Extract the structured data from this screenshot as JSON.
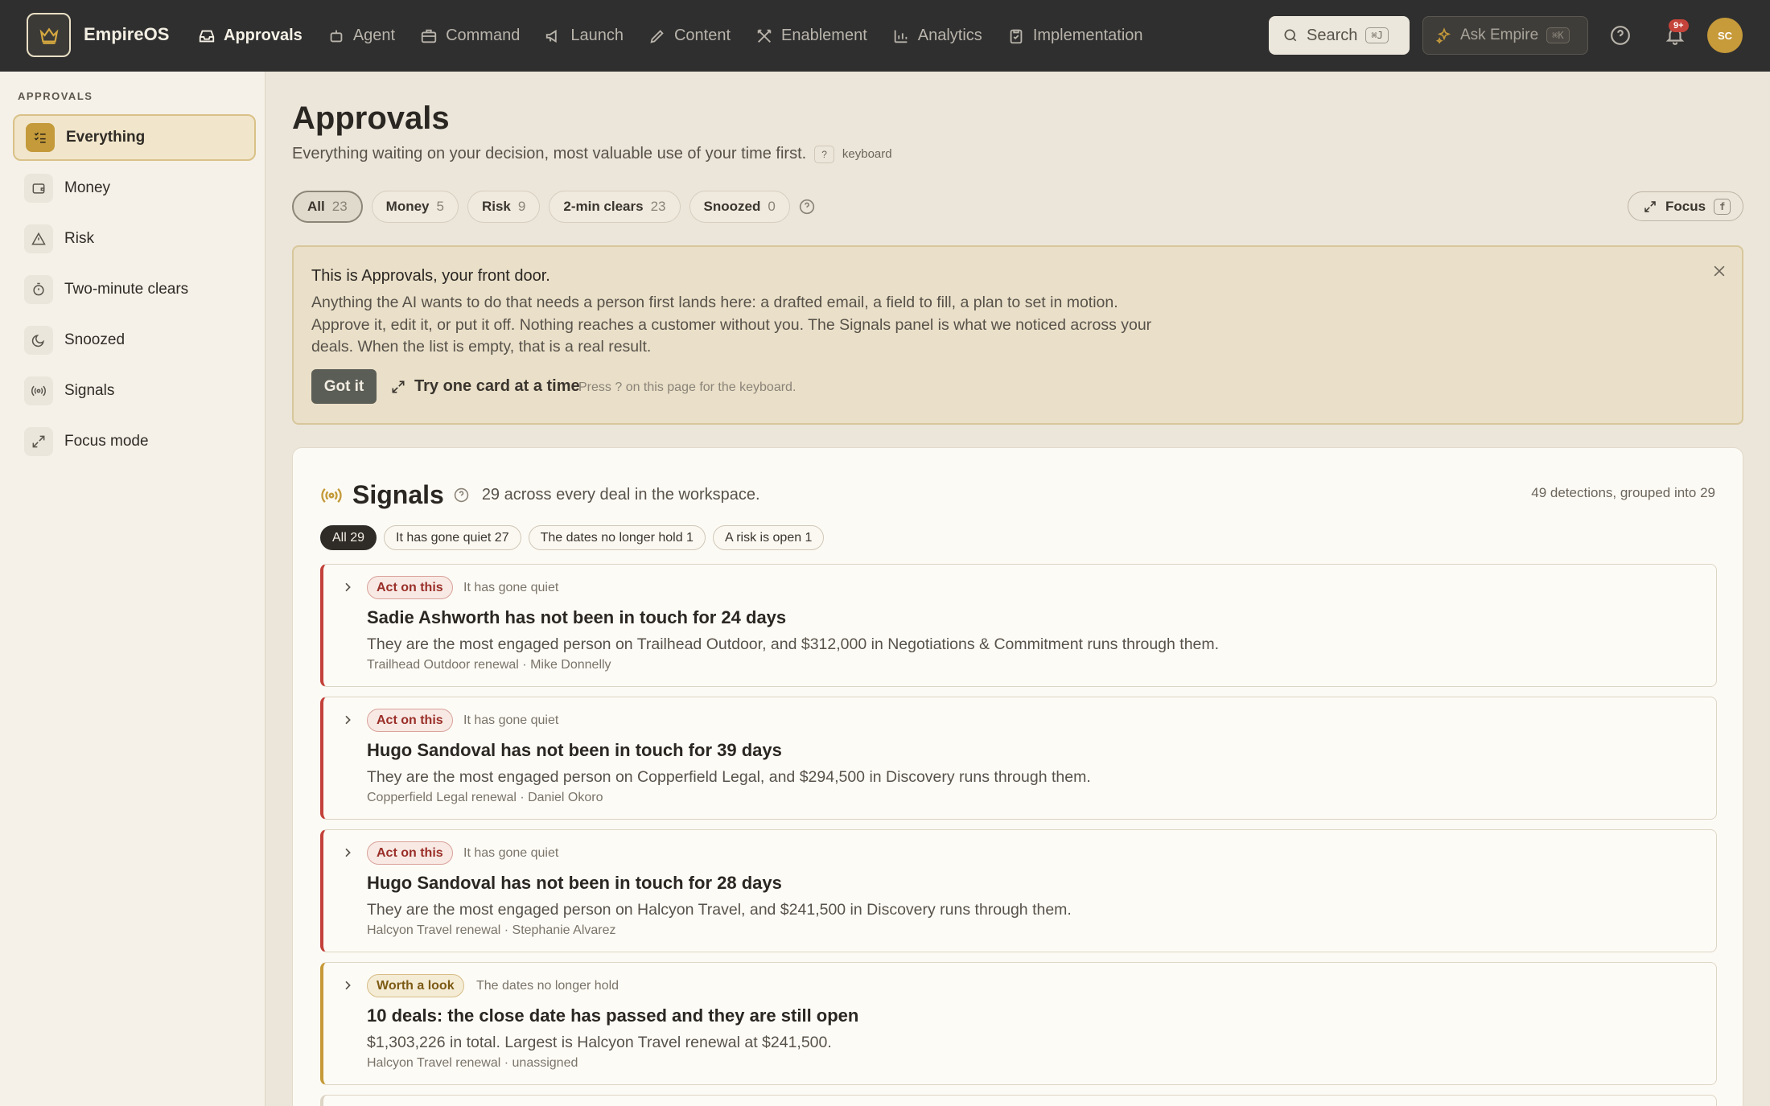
{
  "topbar": {
    "brand": "EmpireOS",
    "nav": [
      {
        "label": "Approvals",
        "icon": "inbox-icon",
        "active": true
      },
      {
        "label": "Agent",
        "icon": "bot-icon"
      },
      {
        "label": "Command",
        "icon": "briefcase-icon"
      },
      {
        "label": "Launch",
        "icon": "megaphone-icon"
      },
      {
        "label": "Content",
        "icon": "pen-icon"
      },
      {
        "label": "Enablement",
        "icon": "crossed-swords-icon"
      },
      {
        "label": "Analytics",
        "icon": "bar-chart-icon"
      },
      {
        "label": "Implementation",
        "icon": "clipboard-check-icon"
      }
    ],
    "search": {
      "label": "Search",
      "shortcut": "⌘J"
    },
    "ask": {
      "label": "Ask Empire",
      "shortcut": "⌘K"
    },
    "notifications_badge": "9+",
    "avatar_initials": "SC"
  },
  "sidebar": {
    "heading": "APPROVALS",
    "items": [
      {
        "label": "Everything",
        "icon": "checklist-icon",
        "active": true
      },
      {
        "label": "Money",
        "icon": "wallet-icon"
      },
      {
        "label": "Risk",
        "icon": "warning-icon"
      },
      {
        "label": "Two-minute clears",
        "icon": "timer-icon"
      },
      {
        "label": "Snoozed",
        "icon": "moon-icon"
      },
      {
        "label": "Signals",
        "icon": "broadcast-icon"
      },
      {
        "label": "Focus mode",
        "icon": "expand-icon"
      }
    ]
  },
  "main": {
    "title": "Approvals",
    "subtitle": "Everything waiting on your decision, most valuable use of your time first.",
    "kbd_hint": "?",
    "kbd_label": "keyboard",
    "filters": [
      {
        "label": "All",
        "count": "23",
        "active": true
      },
      {
        "label": "Money",
        "count": "5"
      },
      {
        "label": "Risk",
        "count": "9"
      },
      {
        "label": "2-min clears",
        "count": "23"
      },
      {
        "label": "Snoozed",
        "count": "0"
      }
    ],
    "focus": {
      "label": "Focus",
      "shortcut": "f"
    }
  },
  "intro": {
    "title": "This is Approvals, your front door.",
    "text": "Anything the AI wants to do that needs a person first lands here: a drafted email, a field to fill, a plan to set in motion. Approve it, edit it, or put it off. Nothing reaches a customer without you. The Signals panel is what we noticed across your deals. When the list is empty, that is a real result.",
    "got_it": "Got it",
    "try_one": "Try one card at a time",
    "press_hint": "Press ? on this page for the keyboard."
  },
  "signals": {
    "title": "Signals",
    "count_text": "29 across every deal in the workspace.",
    "detections": "49 detections, grouped into 29",
    "chips": [
      {
        "label": "All 29",
        "active": true
      },
      {
        "label": "It has gone quiet 27"
      },
      {
        "label": "The dates no longer hold 1"
      },
      {
        "label": "A risk is open 1"
      }
    ],
    "cards": [
      {
        "severity": "Act on this",
        "kind": "It has gone quiet",
        "title": "Sadie Ashworth has not been in touch for 24 days",
        "desc": "They are the most engaged person on Trailhead Outdoor, and $312,000 in Negotiations & Commitment runs through them.",
        "meta": "Trailhead Outdoor renewal · Mike Donnelly",
        "level": "critical"
      },
      {
        "severity": "Act on this",
        "kind": "It has gone quiet",
        "title": "Hugo Sandoval has not been in touch for 39 days",
        "desc": "They are the most engaged person on Copperfield Legal, and $294,500 in Discovery runs through them.",
        "meta": "Copperfield Legal renewal · Daniel Okoro",
        "level": "critical"
      },
      {
        "severity": "Act on this",
        "kind": "It has gone quiet",
        "title": "Hugo Sandoval has not been in touch for 28 days",
        "desc": "They are the most engaged person on Halcyon Travel, and $241,500 in Discovery runs through them.",
        "meta": "Halcyon Travel renewal · Stephanie Alvarez",
        "level": "critical"
      },
      {
        "severity": "Worth a look",
        "kind": "The dates no longer hold",
        "title": "10 deals: the close date has passed and they are still open",
        "desc": "$1,303,226 in total. Largest is Halcyon Travel renewal at $241,500.",
        "meta": "Halcyon Travel renewal · unassigned",
        "level": "warning"
      }
    ]
  },
  "colors": {
    "critical": "#c3413a",
    "warning": "#c69a38",
    "accent": "#c49a3a",
    "topbar": "#2f2f2f"
  }
}
